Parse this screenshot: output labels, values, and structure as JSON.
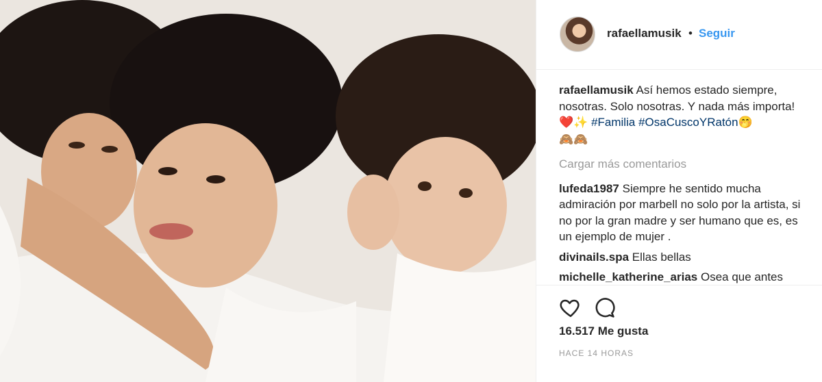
{
  "header": {
    "username": "rafaellamusik",
    "separator": "•",
    "follow_label": "Seguir"
  },
  "caption": {
    "username": "rafaellamusik",
    "text": "Así hemos estado siempre, nosotras. Solo nosotras. Y nada más importa!",
    "emoji_1": "❤️✨",
    "hashtag_1": "#Familia",
    "hashtag_2": "#OsaCuscoYRatón",
    "emoji_2": "🤭",
    "emoji_3": "🙈🙈"
  },
  "load_more_label": "Cargar más comentarios",
  "comments": [
    {
      "username": "lufeda1987",
      "text": "Siempre he sentido mucha admiración por marbell no solo por la artista, si no por la gran madre y ser humano que es, es un ejemplo de mujer ."
    },
    {
      "username": "divinails.spa",
      "text": "Ellas bellas"
    },
    {
      "username": "michelle_katherine_arias",
      "text": "Osea que antes"
    }
  ],
  "actions": {
    "like_icon": "heart-icon",
    "comment_icon": "comment-bubble-icon"
  },
  "likes_text": "16.517 Me gusta",
  "timestamp": "HACE 14 HORAS",
  "colors": {
    "link_blue": "#3897f0",
    "hashtag": "#003569",
    "muted": "#999999",
    "text": "#262626"
  }
}
